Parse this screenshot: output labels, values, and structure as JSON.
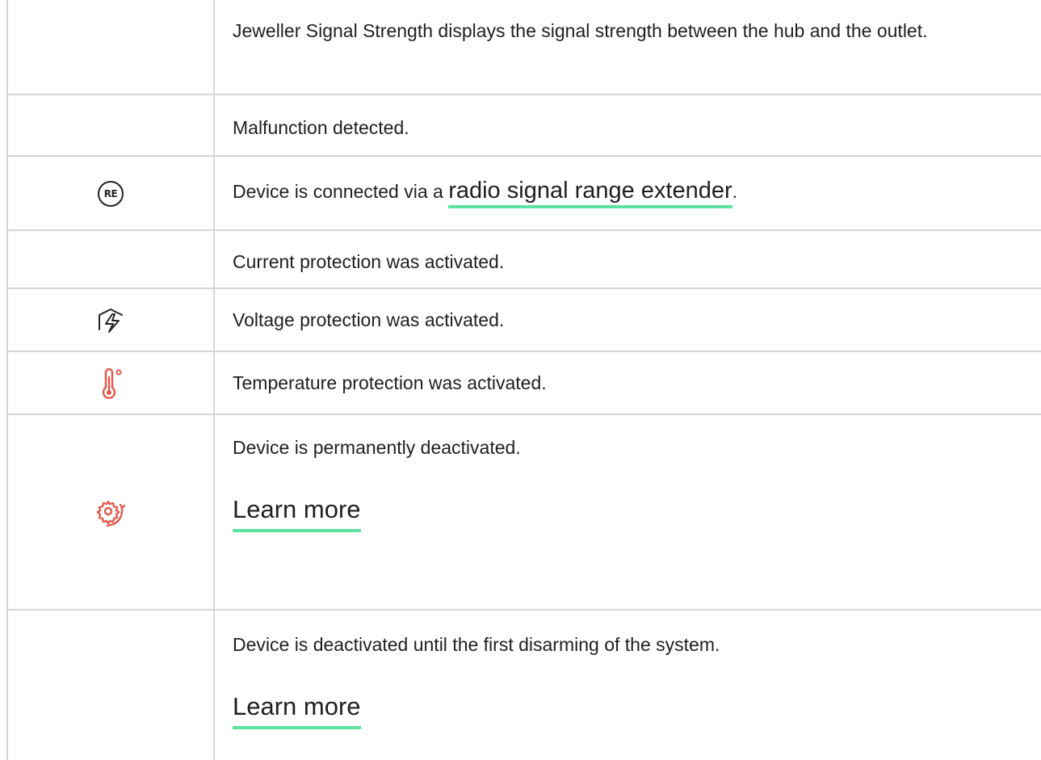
{
  "rows": [
    {
      "icon": "",
      "text": "Jeweller Signal Strength displays the signal strength between the hub and the outlet."
    },
    {
      "icon": "",
      "text": "Malfunction detected."
    },
    {
      "icon": "re-icon",
      "icon_text": "RE",
      "text_before": "Device is connected via a ",
      "link_text": "radio signal range extender",
      "text_after": "."
    },
    {
      "icon": "",
      "text": "Current protection was activated."
    },
    {
      "icon": "voltage-protection-icon",
      "text": "Voltage protection was activated."
    },
    {
      "icon": "thermometer-icon",
      "text": "Temperature protection was activated."
    },
    {
      "icon": "gear-deactivated-icon",
      "text": "Device is permanently deactivated.",
      "link_text": "Learn more"
    },
    {
      "icon": "",
      "text": "Device is deactivated until the first disarming of the system.",
      "link_text": "Learn more"
    }
  ],
  "colors": {
    "text": "#1f1f1f",
    "border": "#d6d6d6",
    "link_underline": "#5ce2a0",
    "icon_dark": "#222222",
    "icon_red": "#e4584b"
  }
}
